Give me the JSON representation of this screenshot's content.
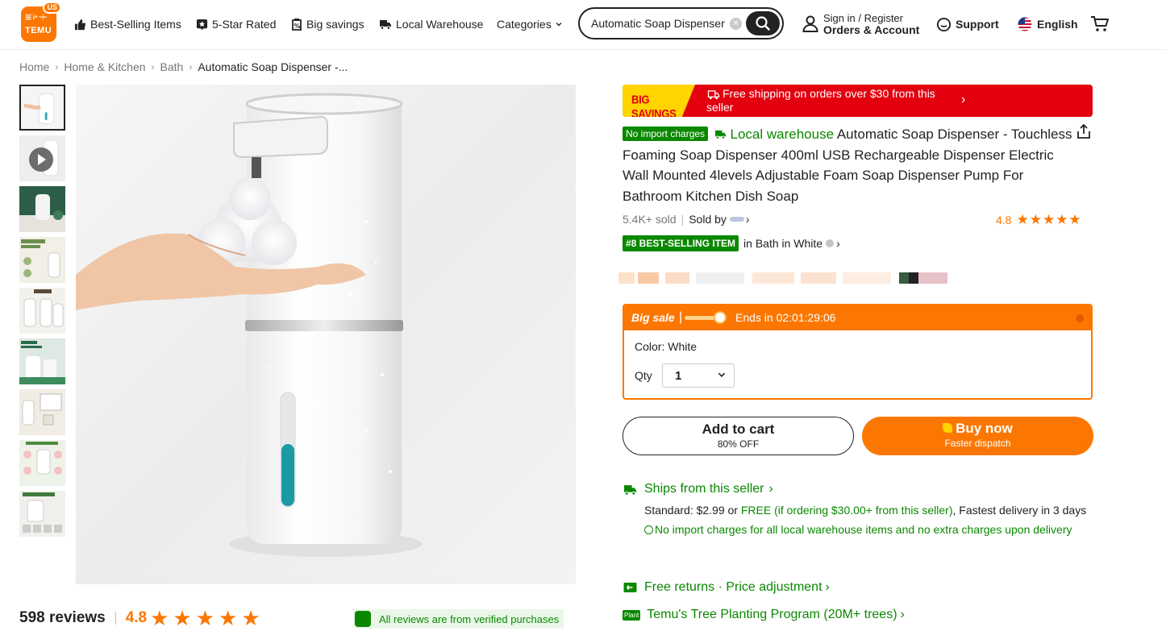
{
  "header": {
    "logo_text": "TEMU",
    "logo_region": "US",
    "nav": [
      {
        "label": "Best-Selling Items",
        "icon": "thumbs-up-icon"
      },
      {
        "label": "5-Star Rated",
        "icon": "star-badge-icon"
      },
      {
        "label": "Big savings",
        "icon": "percent-tag-icon"
      },
      {
        "label": "Local Warehouse",
        "icon": "truck-icon"
      },
      {
        "label": "Categories",
        "icon": "chevron-down-icon"
      }
    ],
    "search": {
      "value": "Automatic Soap Dispenser"
    },
    "account": {
      "line1": "Sign in / Register",
      "line2": "Orders & Account"
    },
    "support": "Support",
    "language": "English"
  },
  "breadcrumb": [
    "Home",
    "Home & Kitchen",
    "Bath",
    "Automatic Soap Dispenser -..."
  ],
  "gallery": {
    "thumbnail_count": 9,
    "selected_index": 0
  },
  "banner": {
    "tag": "BIG SAVINGS",
    "text": "Free shipping on orders over $30 from this seller"
  },
  "product": {
    "no_import_badge": "No import charges",
    "local_warehouse": "Local warehouse",
    "title": "Automatic Soap Dispenser - Touchless Foaming Soap Dispenser 400ml USB Rechargeable Dispenser Electric Wall Mounted 4levels Adjustable Foam Soap Dispenser Pump For Bathroom Kitchen Dish Soap",
    "sold": "5.4K+ sold",
    "sold_by": "Sold by",
    "rating": "4.8",
    "stars": "★★★★★",
    "best_selling_badge": "#8 BEST-SELLING ITEM",
    "best_selling_context": "in Bath in White"
  },
  "deal": {
    "label": "Big sale",
    "ends": "Ends in 02:01:29:06",
    "color_text": "Color: White",
    "qty_label": "Qty",
    "qty_value": "1"
  },
  "buttons": {
    "cart_main": "Add to cart",
    "cart_sub": "80% OFF",
    "buy_main": "Buy now",
    "buy_sub": "Faster dispatch"
  },
  "shipping": {
    "ships_from": "Ships from this seller",
    "std_prefix": "Standard: $2.99 or ",
    "std_free": "FREE (if ordering $30.00+ from this seller)",
    "std_suffix": ", Fastest delivery in 3 days",
    "import_note": "No import charges for all local warehouse items and no extra charges upon delivery",
    "free_returns": "Free returns · Price adjustment",
    "tree_badge": "Plant",
    "tree_program": "Temu's Tree Planting Program (20M+ trees)"
  },
  "reviews": {
    "count": "598 reviews",
    "rating": "4.8",
    "stars": "★★★★★",
    "verified": "All reviews are from verified purchases"
  },
  "colors": {
    "brand_orange": "#fb7701",
    "green": "#0a8800",
    "red": "#e3000f",
    "yellow": "#ffd400"
  }
}
